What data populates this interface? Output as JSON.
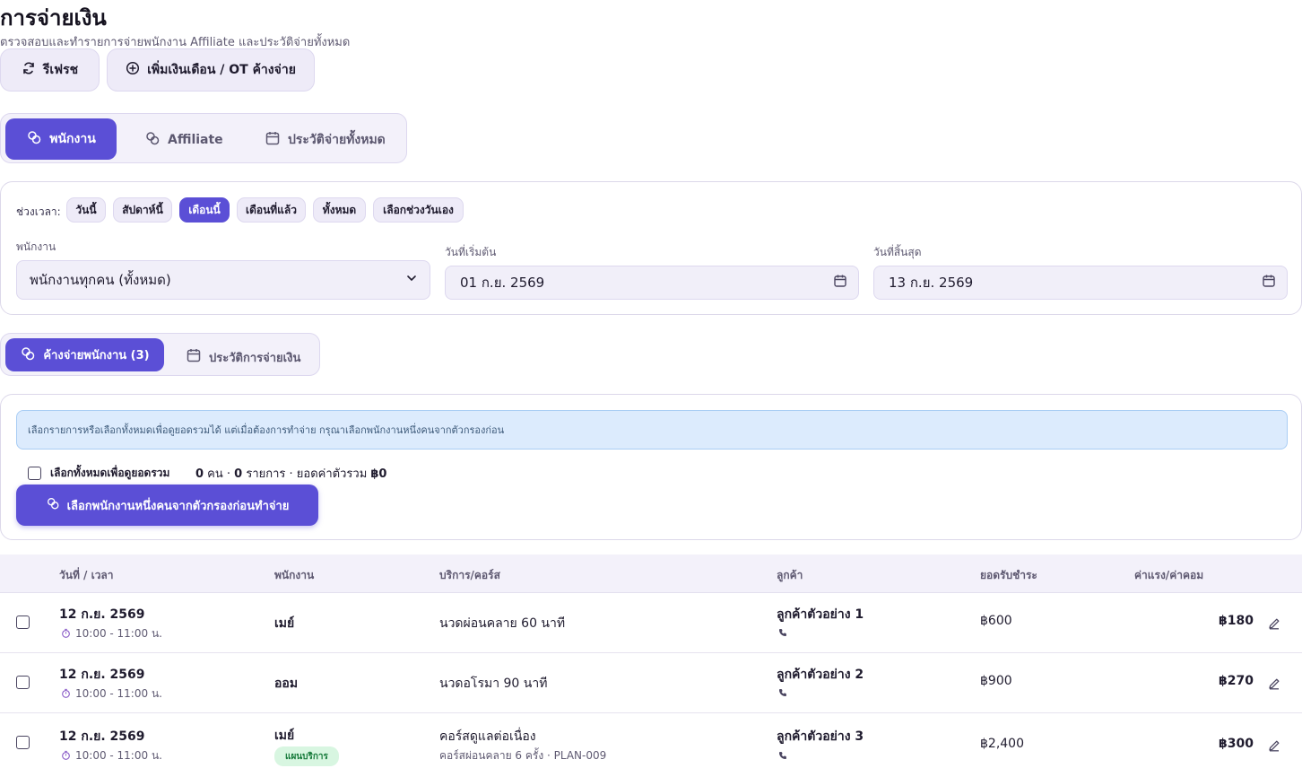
{
  "header": {
    "title": "การจ่ายเงิน",
    "subtitle": "ตรวจสอบและทำรายการจ่ายพนักงาน Affiliate และประวัติจ่ายทั้งหมด"
  },
  "toolbar": {
    "refresh_label": "รีเฟรช",
    "add_salary_label": "เพิ่มเงินเดือน / OT ค้างจ่าย"
  },
  "main_tabs": [
    {
      "label": "พนักงาน",
      "active": true
    },
    {
      "label": "Affiliate",
      "active": false
    },
    {
      "label": "ประวัติจ่ายทั้งหมด",
      "active": false
    }
  ],
  "filters": {
    "range_label": "ช่วงเวลา:",
    "ranges": [
      {
        "label": "วันนี้",
        "active": false
      },
      {
        "label": "สัปดาห์นี้",
        "active": false
      },
      {
        "label": "เดือนนี้",
        "active": true
      },
      {
        "label": "เดือนที่แล้ว",
        "active": false
      },
      {
        "label": "ทั้งหมด",
        "active": false
      },
      {
        "label": "เลือกช่วงวันเอง",
        "active": false
      }
    ],
    "employee_label": "พนักงาน",
    "employee_value": "พนักงานทุกคน (ทั้งหมด)",
    "start_label": "วันที่เริ่มต้น",
    "start_value": "01 ก.ย. 2569",
    "end_label": "วันที่สิ้นสุด",
    "end_value": "13 ก.ย. 2569"
  },
  "sub_tabs": [
    {
      "label": "ค้างจ่ายพนักงาน (3)",
      "active": true
    },
    {
      "label": "ประวัติการจ่ายเงิน",
      "active": false
    }
  ],
  "action": {
    "notice": "เลือกรายการหรือเลือกทั้งหมดเพื่อดูยอดรวมได้ แต่เมื่อต้องการทำจ่าย กรุณาเลือกพนักงานหนึ่งคนจากตัวกรองก่อน",
    "select_all_label": "เลือกทั้งหมดเพื่อดูยอดรวม",
    "summary_people": "0",
    "summary_people_unit": " คน · ",
    "summary_items": "0",
    "summary_items_unit": " รายการ · ยอดค่าตัวรวม ",
    "summary_total": "฿0",
    "primary_label": "เลือกพนักงานหนึ่งคนจากตัวกรองก่อนทำจ่าย"
  },
  "table": {
    "headers": {
      "datetime": "วันที่ / เวลา",
      "employee": "พนักงาน",
      "service": "บริการ/คอร์ส",
      "customer": "ลูกค้า",
      "payment": "ยอดรับชำระ",
      "commission": "ค่าแรง/ค่าคอม"
    },
    "rows": [
      {
        "date": "12 ก.ย. 2569",
        "time": "10:00 - 11:00 น.",
        "employee": "เมย์",
        "badge": "",
        "service": "นวดผ่อนคลาย 60 นาที",
        "service_sub": "",
        "customer": "ลูกค้าตัวอย่าง 1",
        "payment": "฿600",
        "commission": "฿180"
      },
      {
        "date": "12 ก.ย. 2569",
        "time": "10:00 - 11:00 น.",
        "employee": "ออม",
        "badge": "",
        "service": "นวดอโรมา 90 นาที",
        "service_sub": "",
        "customer": "ลูกค้าตัวอย่าง 2",
        "payment": "฿900",
        "commission": "฿270"
      },
      {
        "date": "12 ก.ย. 2569",
        "time": "10:00 - 11:00 น.",
        "employee": "เมย์",
        "badge": "แผนบริการ",
        "service": "คอร์สดูแลต่อเนื่อง",
        "service_sub": "คอร์สผ่อนคลาย 6 ครั้ง · PLAN-009",
        "customer": "ลูกค้าตัวอย่าง 3",
        "payment": "฿2,400",
        "commission": "฿300"
      }
    ]
  }
}
